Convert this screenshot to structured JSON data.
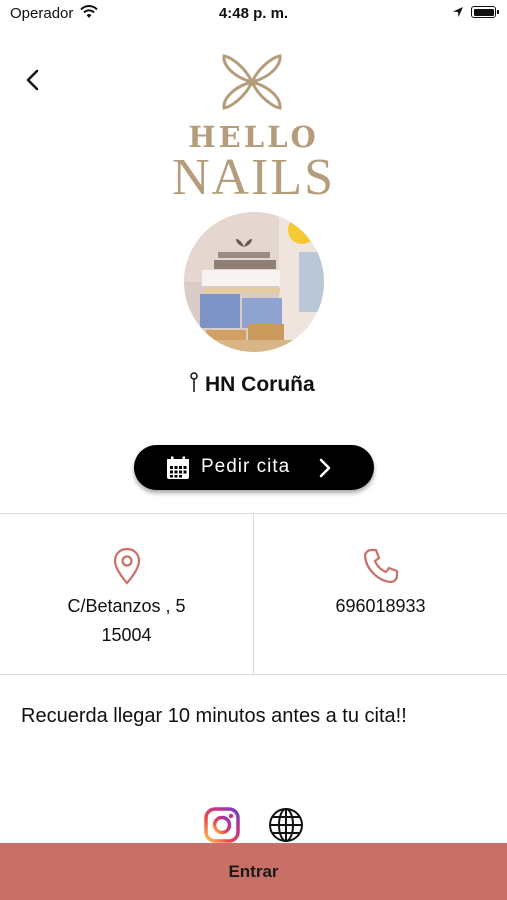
{
  "status_bar": {
    "carrier": "Operador",
    "time": "4:48 p. m."
  },
  "brand": {
    "logo_line1": "HELLO",
    "logo_line2": "NAILS",
    "color": "#b59d7c"
  },
  "salon": {
    "name": "HN Coruña"
  },
  "booking_button": {
    "label": "Pedir cita",
    "icon": "calendar-icon"
  },
  "address": {
    "icon": "location-pin-icon",
    "street": "C/Betanzos , 5",
    "postal_code": "15004"
  },
  "phone": {
    "icon": "phone-icon",
    "number": "696018933"
  },
  "reminder": "Recuerda llegar 10 minutos antes a tu cita!!",
  "social": [
    "instagram-icon",
    "globe-icon"
  ],
  "footer": {
    "enter_label": "Entrar",
    "color": "#c87068"
  },
  "colors": {
    "accent": "#c87068",
    "button": "#000000"
  }
}
